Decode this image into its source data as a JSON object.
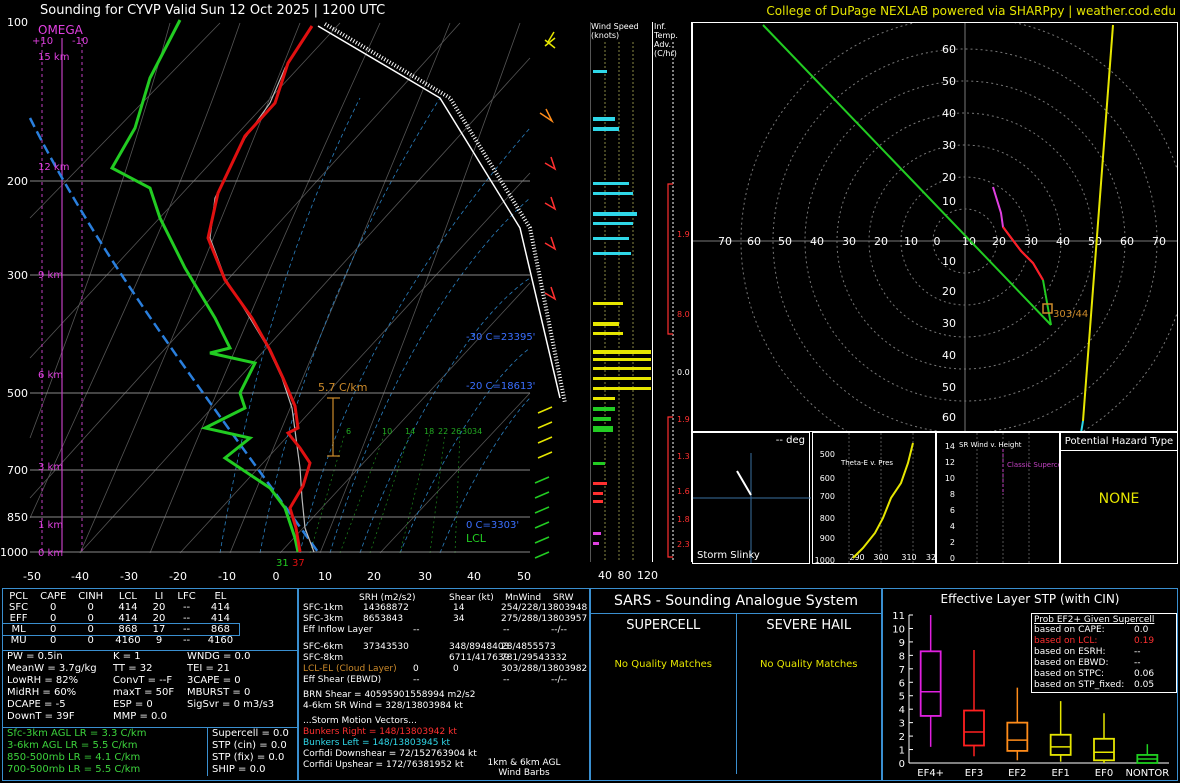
{
  "header": {
    "title": "Sounding for CYVP Valid  Sun 12 Oct 2025 | 1200 UTC",
    "credit": "College of DuPage NEXLAB powered via SHARPpy | weather.cod.edu"
  },
  "skewt": {
    "omega_label": "OMEGA",
    "omega_ticks": [
      "+10",
      "-10"
    ],
    "pressure_labels": [
      "100",
      "200",
      "300",
      "500",
      "700",
      "850",
      "1000"
    ],
    "temp_labels": [
      "-50",
      "-40",
      "-30",
      "-20",
      "-10",
      "0",
      "10",
      "20",
      "30",
      "40",
      "50"
    ],
    "height_labels": [
      "15 km",
      "12 km",
      "9 km",
      "6 km",
      "3 km",
      "1 km",
      "0 km"
    ],
    "lapse_label": "5.7 C/km",
    "levels": [
      "-30 C=23395'",
      "-20 C=18613'",
      "0 C=3303'"
    ],
    "lcl_label": "LCL",
    "sfc_temps": [
      "31",
      "37"
    ],
    "mixing_ratio_labels": [
      "6",
      "10",
      "14",
      "18",
      "22",
      "26",
      "30",
      "34"
    ]
  },
  "wind_speed_panel": {
    "title": "Wind Speed (knots)",
    "ticks": [
      "40",
      "80",
      "120"
    ]
  },
  "inferred_temp": {
    "title": "Inf. Temp. Adv. (C/hr)",
    "values": [
      "1.9",
      "8.0",
      "0.0",
      "1.9",
      "1.3",
      "1.6",
      "1.8",
      "2.3"
    ]
  },
  "hodograph": {
    "ring_labels_x": [
      "70",
      "60",
      "50",
      "40",
      "30",
      "20",
      "10",
      "0",
      "10",
      "20",
      "30",
      "40",
      "50",
      "60",
      "70"
    ],
    "ring_labels_y": [
      "60",
      "50",
      "40",
      "30",
      "20",
      "10",
      "10",
      "20",
      "30",
      "40",
      "50",
      "60"
    ],
    "storm_motion_label": "303/44"
  },
  "storm_slinky": {
    "title": "-- deg",
    "label": "Storm Slinky"
  },
  "theta_e": {
    "title": "Theta-E v. Pres",
    "pressure_ticks": [
      "500",
      "600",
      "700",
      "800",
      "900",
      "1000"
    ],
    "theta_ticks": [
      "290",
      "300",
      "310",
      "32"
    ]
  },
  "sr_wind": {
    "title": "SR Wind v. Height",
    "height_ticks": [
      "14",
      "12",
      "10",
      "8",
      "6",
      "4",
      "2",
      "0"
    ],
    "label": "Classic Supercell"
  },
  "hazard": {
    "title": "Potential Hazard Type",
    "value": "NONE"
  },
  "parcel_table": {
    "headers": [
      "PCL",
      "CAPE",
      "CINH",
      "LCL",
      "LI",
      "LFC",
      "EL"
    ],
    "rows": [
      [
        "SFC",
        "0",
        "0",
        "414",
        "20",
        "--",
        "414"
      ],
      [
        "EFF",
        "0",
        "0",
        "414",
        "20",
        "--",
        "414"
      ],
      [
        "ML",
        "0",
        "0",
        "868",
        "17",
        "--",
        "868"
      ],
      [
        "MU",
        "0",
        "0",
        "4160",
        "9",
        "--",
        "4160"
      ]
    ]
  },
  "indices": {
    "col1": [
      "PW = 0.5in",
      "MeanW = 3.7g/kg",
      "LowRH = 82%",
      "MidRH = 60%",
      "DCAPE = -5",
      "DownT = 39F"
    ],
    "col2": [
      "K = 1",
      "TT = 32",
      "ConvT = --F",
      "maxT = 50F",
      "ESP = 0",
      "MMP = 0.0"
    ],
    "col3": [
      "WNDG = 0.0",
      "TEI = 21",
      "3CAPE = 0",
      "MBURST = 0",
      "",
      "SigSvr = 0 m3/s3"
    ]
  },
  "lapse_rates": [
    "Sfc-3km AGL LR = 3.3 C/km",
    "3-6km AGL LR = 5.5 C/km",
    "850-500mb LR = 4.1 C/km",
    "700-500mb LR = 5.5 C/km"
  ],
  "composite": [
    "Supercell = 0.0",
    "STP (cin) = 0.0",
    "STP (fix) = 0.0",
    "SHIP = 0.0"
  ],
  "kinematics": {
    "headers": [
      "SRH (m2/s2)",
      "Shear (kt)",
      "MnWind",
      "SRW"
    ],
    "rows": [
      [
        "SFC-1km",
        "14368872",
        "14",
        "254/228/13803948"
      ],
      [
        "SFC-3km",
        "8653843",
        "34",
        "275/288/13803957"
      ],
      [
        "Eff Inflow Layer",
        "--",
        "--",
        "--/--"
      ],
      [
        "SFC-6km",
        "37343530",
        "348/8948403",
        "28/4855573"
      ],
      [
        "SFC-8km",
        "",
        "6711/417639",
        "781/29543332"
      ],
      [
        "LCL-EL (Cloud Layer)",
        "0",
        "0",
        "303/288/13803982"
      ],
      [
        "Eff Shear (EBWD)",
        "--",
        "--",
        "--/--"
      ]
    ],
    "brn": "BRN Shear = 40595901558994 m2/s2",
    "srwind46": "4-6km SR Wind =  328/13803984 kt",
    "storm_motion_title": "...Storm Motion Vectors...",
    "bunkers_right": "Bunkers Right =     148/13803942 kt",
    "bunkers_left": "Bunkers Left =      148/13803945 kt",
    "corfidi_down": "Corfidi Downshear = 72/152763904 kt",
    "corfidi_up": "Corfidi Upshear =  172/76381952 kt",
    "barb_label": "1km & 6km AGL Wind Barbs"
  },
  "sars": {
    "title": "SARS - Sounding Analogue System",
    "supercell": "SUPERCELL",
    "hail": "SEVERE HAIL",
    "sup_matches": "No Quality Matches",
    "hail_matches": "No Quality Matches"
  },
  "stp": {
    "title": "Effective Layer STP (with CIN)",
    "y_ticks": [
      "11",
      "10",
      "9",
      "8",
      "7",
      "6",
      "5",
      "4",
      "3",
      "2",
      "1",
      "0"
    ],
    "categories": [
      "EF4+",
      "EF3",
      "EF2",
      "EF1",
      "EF0",
      "NONTOR"
    ],
    "colors": [
      "#e020e0",
      "#ff2020",
      "#ff8c1a",
      "#e6e600",
      "#e6e600",
      "#20d020"
    ],
    "prob_title": "Prob EF2+ Given Supercell",
    "prob_rows": [
      [
        "based on CAPE:",
        "0.0"
      ],
      [
        "based on LCL:",
        "0.19"
      ],
      [
        "based on ESRH:",
        "--"
      ],
      [
        "based on EBWD:",
        "--"
      ],
      [
        "based on STPC:",
        "0.06"
      ],
      [
        "based on STP_fixed:",
        "0.05"
      ]
    ]
  },
  "chart_data": [
    {
      "type": "box",
      "title": "Effective Layer STP (with CIN)",
      "categories": [
        "EF4+",
        "EF3",
        "EF2",
        "EF1",
        "EF0",
        "NONTOR"
      ],
      "whisker_low": [
        1.2,
        0.5,
        0.2,
        0.1,
        0.0,
        0.0
      ],
      "q1": [
        3.5,
        1.3,
        0.9,
        0.6,
        0.2,
        0.0
      ],
      "median": [
        5.3,
        2.3,
        1.7,
        1.2,
        0.8,
        0.3
      ],
      "q3": [
        8.3,
        3.9,
        3.0,
        2.1,
        1.8,
        0.6
      ],
      "whisker_high": [
        11.0,
        8.4,
        5.6,
        4.6,
        3.7,
        1.4
      ],
      "ylim": [
        0,
        11
      ]
    }
  ]
}
